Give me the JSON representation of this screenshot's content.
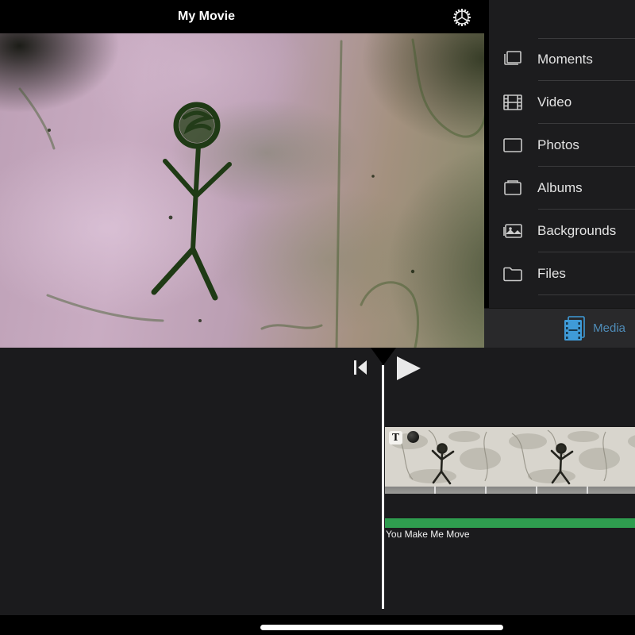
{
  "viewer": {
    "title": "My Movie",
    "gear_icon": "settings-gear"
  },
  "sidebar": {
    "items": [
      {
        "label": "Moments",
        "icon": "moments-icon"
      },
      {
        "label": "Video",
        "icon": "video-icon"
      },
      {
        "label": "Photos",
        "icon": "photos-icon"
      },
      {
        "label": "Albums",
        "icon": "albums-icon"
      },
      {
        "label": "Backgrounds",
        "icon": "backgrounds-icon"
      },
      {
        "label": "Files",
        "icon": "files-icon"
      }
    ],
    "bottom_bar": {
      "label": "Media",
      "icon": "media-film-icon",
      "active_color": "#3f9bd8"
    }
  },
  "transport": {
    "skip_icon": "skip-to-start-icon",
    "play_icon": "play-icon"
  },
  "timeline": {
    "clip": {
      "title_badge": "T",
      "badges": [
        "title-badge",
        "filter-badge"
      ]
    },
    "audio_track": {
      "label": "You Make Me Move",
      "color": "#2f9d4f"
    }
  },
  "colors": {
    "sidebar_bg": "#1c1c1e",
    "media_bar_bg": "#29292b",
    "timeline_bg": "#1b1b1d",
    "audio_green": "#2f9d4f",
    "media_blue": "#3f9bd8"
  }
}
